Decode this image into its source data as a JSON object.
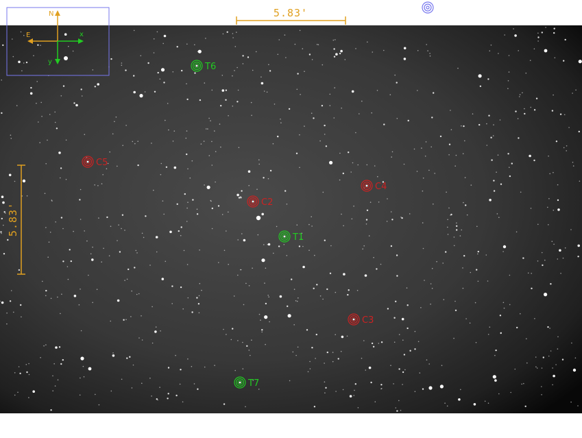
{
  "colors": {
    "target": "#22cc22",
    "comparison": "#cc2222",
    "scale": "#e0a020",
    "compass_box": "#7777ee",
    "sky_center": "#444444",
    "sky_edge": "#0c0c0c"
  },
  "scale_bar": {
    "horizontal_label": "5.83'",
    "vertical_label": "5.83'"
  },
  "compass": {
    "north": "N",
    "east": "E",
    "x_axis": "x",
    "y_axis": "y"
  },
  "top_marker_icon": "target-reticle-icon",
  "markers": [
    {
      "id": "T6",
      "kind": "target"
    },
    {
      "id": "C5",
      "kind": "comparison"
    },
    {
      "id": "C4",
      "kind": "comparison"
    },
    {
      "id": "C2",
      "kind": "comparison"
    },
    {
      "id": "T1",
      "kind": "target"
    },
    {
      "id": "C3",
      "kind": "comparison"
    },
    {
      "id": "T7",
      "kind": "target"
    }
  ]
}
